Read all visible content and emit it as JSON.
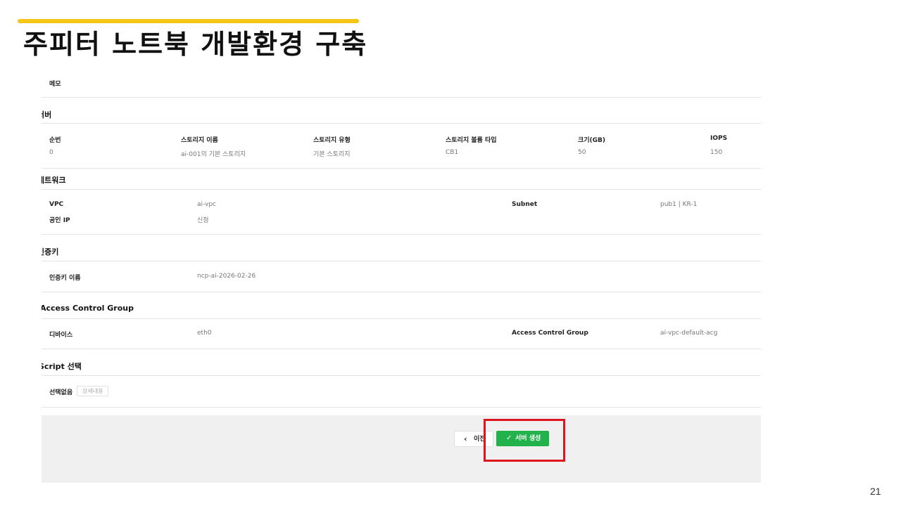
{
  "slide": {
    "title": "주피터 노트북 개발환경 구축",
    "page_number": "21",
    "accent_color": "#f5c518",
    "highlight_color": "#e0141e"
  },
  "memo": {
    "label": "메모"
  },
  "server": {
    "section_title": "서버",
    "columns": [
      "순번",
      "스토리지 이름",
      "스토리지 유형",
      "스토리지 볼륨 타입",
      "크기(GB)",
      "IOPS"
    ],
    "rows": [
      [
        "0",
        "ai-001의 기본 스토리지",
        "기본 스토리지",
        "CB1",
        "50",
        "150"
      ]
    ]
  },
  "network": {
    "section_title": "네트워크",
    "vpc_label": "VPC",
    "vpc_value": "ai-vpc",
    "subnet_label": "Subnet",
    "subnet_value": "pub1 | KR-1",
    "public_ip_label": "공인 IP",
    "public_ip_value": "신청"
  },
  "auth_key": {
    "section_title": "인증키",
    "name_label": "인증키 이름",
    "name_value": "ncp-ai-2026-02-26"
  },
  "acg": {
    "section_title": "Access Control Group",
    "device_label": "디바이스",
    "device_value": "eth0",
    "acg_label": "Access Control Group",
    "acg_value": "ai-vpc-default-acg"
  },
  "script": {
    "section_title": "Script 선택",
    "selection_label": "선택없음",
    "detail_button": "상세내용"
  },
  "footer": {
    "prev_button": "이전",
    "create_button": "서버 생성",
    "create_button_color": "#22b24c"
  }
}
